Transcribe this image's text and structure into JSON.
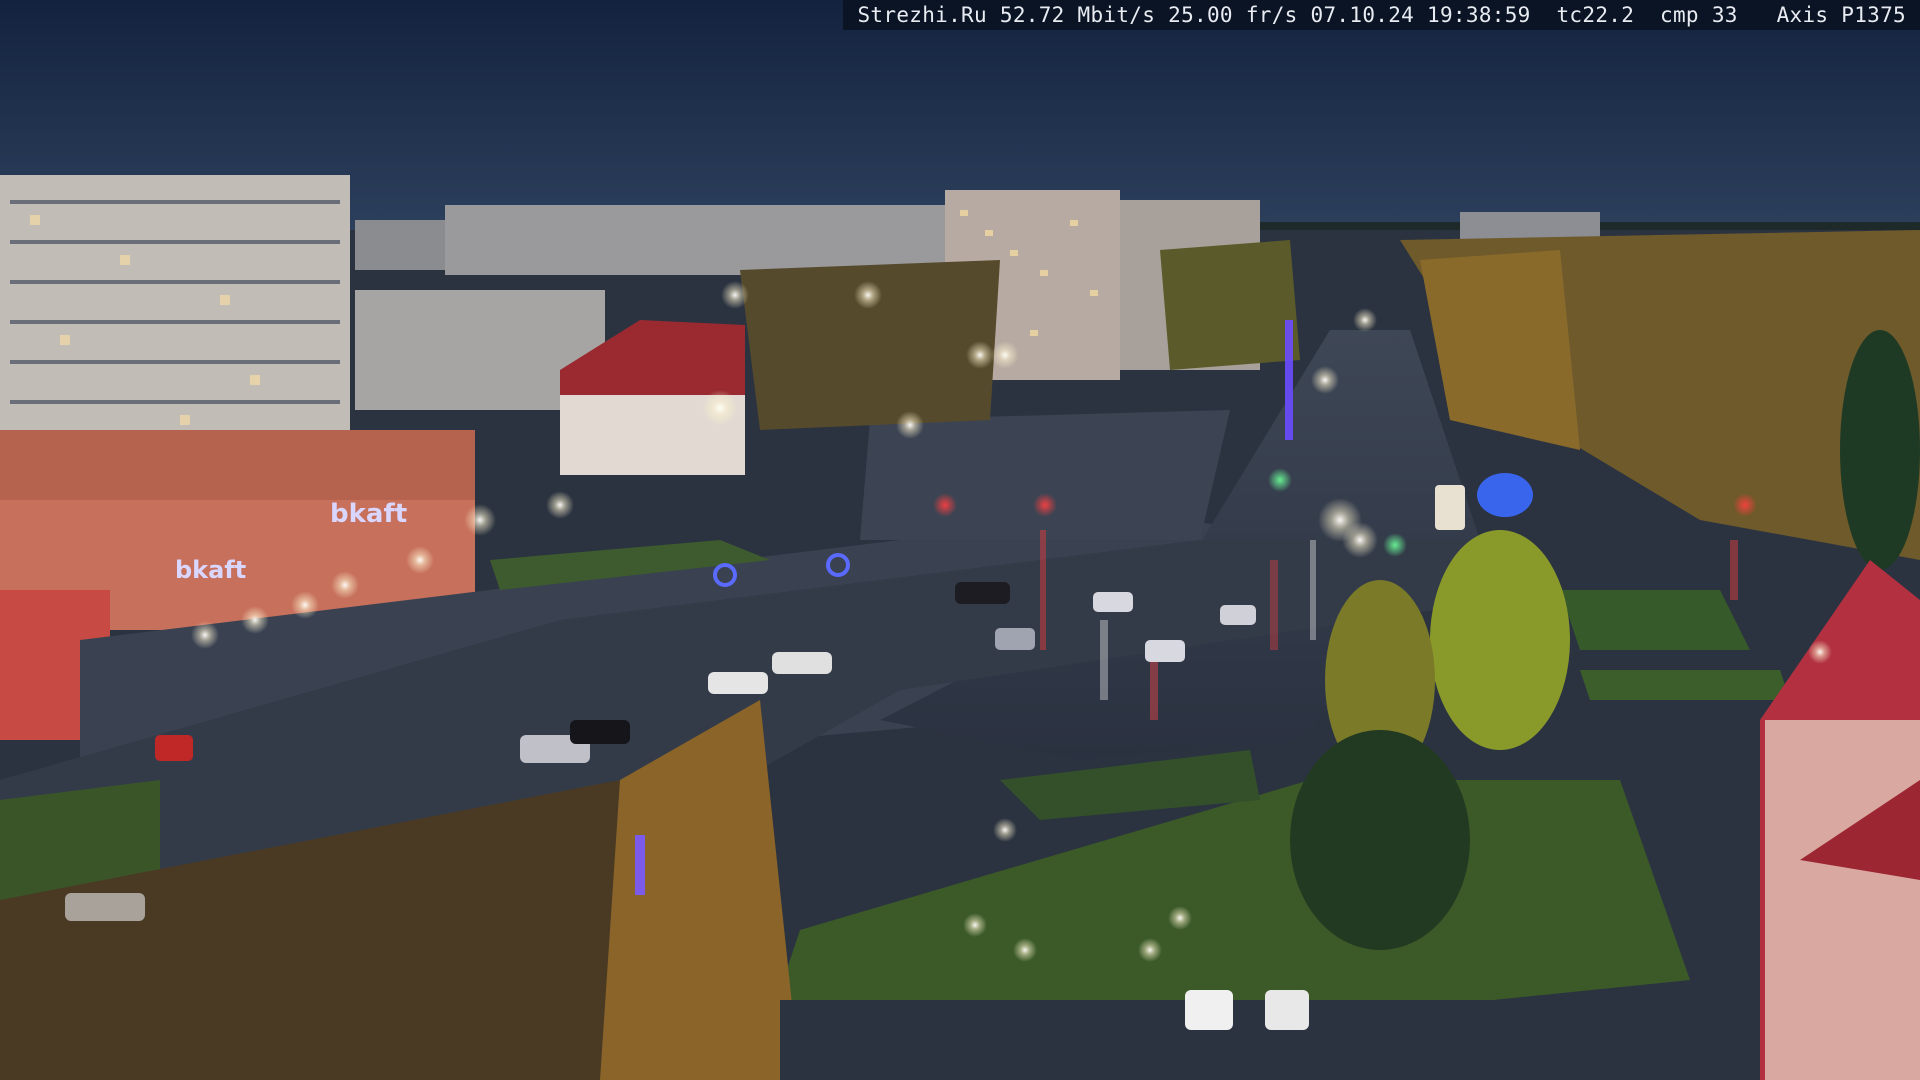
{
  "overlay": {
    "site": "Strezhi.Ru",
    "bitrate": "52.72 Mbit/s",
    "framerate": "25.00 fr/s",
    "date": "07.10.24",
    "time": "19:38:59",
    "tc": "tc22.2",
    "cmp": "cmp 33",
    "camera": "Axis P1375"
  },
  "signs": {
    "store_left": "bkaft",
    "store_mid": "bkaft"
  }
}
